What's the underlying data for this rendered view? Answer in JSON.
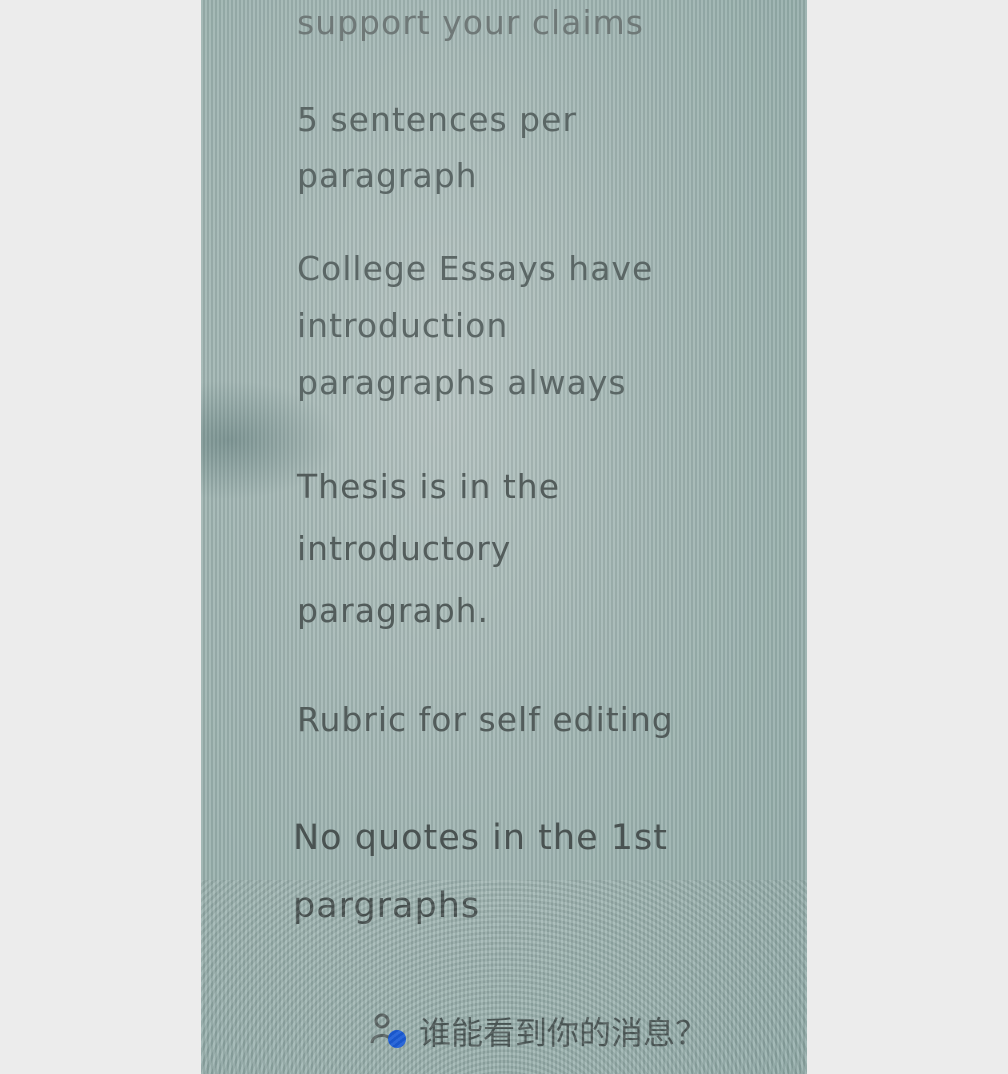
{
  "notes": [
    "support your claims",
    "5 sentences per\nparagraph",
    "College Essays have\nintroduction\nparagraphs always",
    "Thesis is in the\nintroductory\nparagraph.",
    "Rubric for self editing",
    "No quotes in the 1st\npargraphs"
  ],
  "footer": {
    "icon": "person-visibility-icon",
    "prompt": "谁能看到你的消息？"
  },
  "colors": {
    "screen_tint": "#9fb4b1",
    "text": "#55605f",
    "icon_accent": "#1a5bd6"
  }
}
